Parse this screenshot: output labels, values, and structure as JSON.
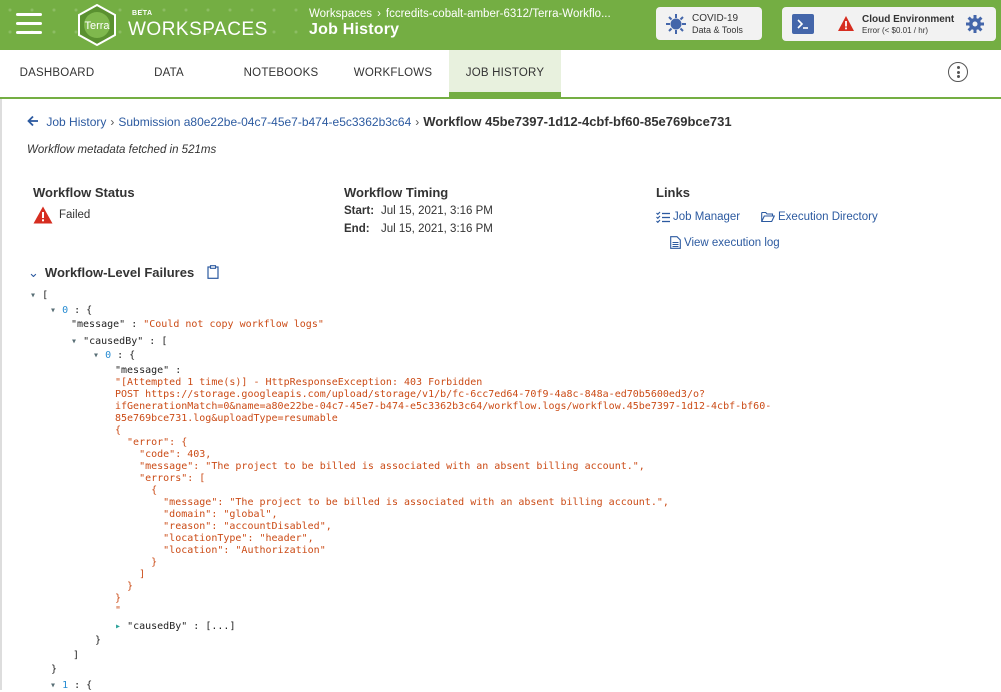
{
  "header": {
    "brand_beta": "BETA",
    "brand_title": "WORKSPACES",
    "logo_text": "Terra",
    "breadcrumb": [
      "Workspaces",
      "fccredits-cobalt-amber-6312/Terra-Workflo..."
    ],
    "page_title": "Job History",
    "covid_button": {
      "line1": "COVID-19",
      "line2": "Data & Tools"
    },
    "cloud_env": {
      "title": "Cloud Environment",
      "subtitle": "Error (< $0.01 / hr)"
    }
  },
  "tabs": [
    {
      "label": "DASHBOARD"
    },
    {
      "label": "DATA"
    },
    {
      "label": "NOTEBOOKS"
    },
    {
      "label": "WORKFLOWS"
    },
    {
      "label": "JOB HISTORY",
      "active": true
    }
  ],
  "breadcrumb": {
    "job_history": "Job History",
    "submission": "Submission a80e22be-04c7-45e7-b474-e5c3362b3c64",
    "workflow": "Workflow 45be7397-1d12-4cbf-bf60-85e769bce731"
  },
  "fetched_text": "Workflow metadata fetched in 521ms",
  "status": {
    "heading": "Workflow Status",
    "value": "Failed"
  },
  "timing": {
    "heading": "Workflow Timing",
    "start_label": "Start:",
    "start": "Jul 15, 2021, 3:16 PM",
    "end_label": "End:",
    "end": "Jul 15, 2021, 3:16 PM"
  },
  "links": {
    "heading": "Links",
    "job_manager": "Job Manager",
    "execution_directory": "Execution Directory",
    "view_log": "View execution log"
  },
  "failures": {
    "heading": "Workflow-Level Failures",
    "json_lines": {
      "l01": "[",
      "l02": "0",
      "l03": "\"message\"",
      "l03v": "\"Could not copy workflow logs\"",
      "l04": "\"causedBy\"",
      "l05": "0",
      "l06": "\"message\"",
      "m01": "\"[Attempted 1 time(s)] - HttpResponseException: 403 Forbidden",
      "m02": "POST https://storage.googleapis.com/upload/storage/v1/b/fc-6cc7ed64-70f9-4a8c-848a-ed70b5600ed3/o?",
      "m03": "ifGenerationMatch=0&name=a80e22be-04c7-45e7-b474-e5c3362b3c64/workflow.logs/workflow.45be7397-1d12-4cbf-bf60-",
      "m04": "85e769bce731.log&uploadType=resumable",
      "m05": "{",
      "m06": "  \"error\": {",
      "m07": "    \"code\": 403,",
      "m08": "    \"message\": \"The project to be billed is associated with an absent billing account.\",",
      "m09": "    \"errors\": [",
      "m10": "      {",
      "m11": "        \"message\": \"The project to be billed is associated with an absent billing account.\",",
      "m12": "        \"domain\": \"global\",",
      "m13": "        \"reason\": \"accountDisabled\",",
      "m14": "        \"locationType\": \"header\",",
      "m15": "        \"location\": \"Authorization\"",
      "m16": "      }",
      "m17": "    ]",
      "m18": "  }",
      "m19": "}",
      "m20": "\"",
      "l07": "\"causedBy\"",
      "l07v": "...",
      "l08": "1"
    }
  }
}
